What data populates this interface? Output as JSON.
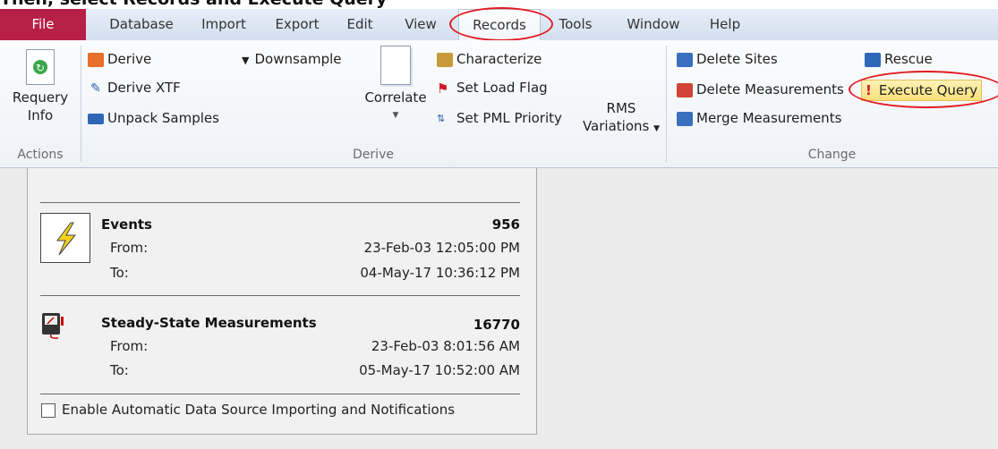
{
  "caption": "Then, select Records and Execute Query",
  "tabs": [
    "File",
    "Database",
    "Import",
    "Export",
    "Edit",
    "View",
    "Records",
    "Tools",
    "Window",
    "Help"
  ],
  "ribbon": {
    "actions": {
      "requery_label": "Requery",
      "requery_label2": "Info",
      "group_label": "Actions"
    },
    "derive": {
      "derive": "Derive",
      "derive_xtf": "Derive XTF",
      "unpack_samples": "Unpack Samples",
      "downsample": "Downsample",
      "correlate": "Correlate",
      "characterize": "Characterize",
      "set_load_flag": "Set Load Flag",
      "set_pml_priority": "Set PML Priority",
      "rms_variations_1": "RMS",
      "rms_variations_2": "Variations",
      "group_label": "Derive"
    },
    "change": {
      "delete_sites": "Delete Sites",
      "delete_measurements": "Delete Measurements",
      "merge_measurements": "Merge Measurements",
      "rescue": "Rescue",
      "execute_query": "Execute Query",
      "group_label": "Change"
    }
  },
  "summary": {
    "events": {
      "title": "Events",
      "count": "956",
      "from_label": "From:",
      "from": "23-Feb-03 12:05:00 PM",
      "to_label": "To:",
      "to": "04-May-17 10:36:12 PM"
    },
    "steady": {
      "title": "Steady-State Measurements",
      "count": "16770",
      "from_label": "From:",
      "from": "23-Feb-03 8:01:56 AM",
      "to_label": "To:",
      "to": "05-May-17 10:52:00 AM"
    },
    "checkbox_label": "Enable Automatic Data Source Importing and Notifications",
    "checkbox_checked": false
  },
  "colors": {
    "file_tab": "#b72046",
    "highlight_ring": "#e21b23",
    "execute_query_bg": "#fbe07a"
  }
}
